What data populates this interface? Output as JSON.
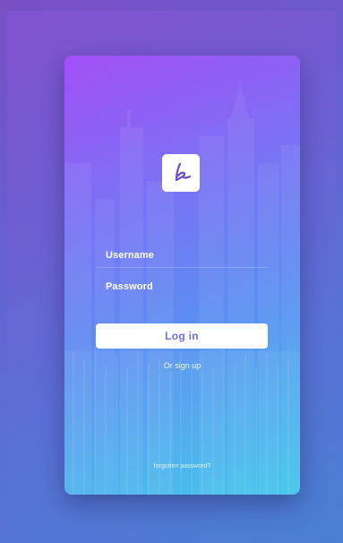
{
  "login": {
    "logo_icon": "signature-b-icon",
    "username_placeholder": "Username",
    "password_placeholder": "Password",
    "login_label": "Log in",
    "signup_label": "Or sign up",
    "forgot_label": "forgotten password?"
  },
  "colors": {
    "background": "#5b6ed6",
    "card_gradient_start": "#a24ff5",
    "card_gradient_end": "#38c3ea",
    "button_text": "#6d6ee6"
  }
}
